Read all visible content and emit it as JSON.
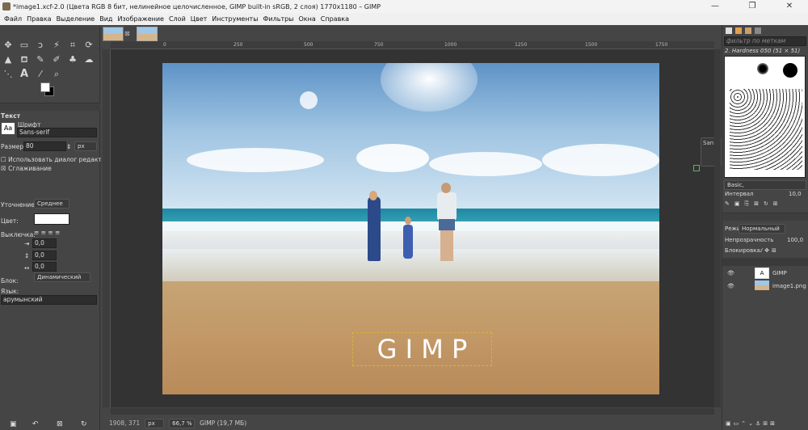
{
  "window": {
    "title": "*image1.xcf-2.0 (Цвета RGB 8 бит, нелинейное целочисленное, GIMP built-in sRGB, 2 слоя) 1770x1180 – GIMP",
    "minimize": "—",
    "maximize": "❐",
    "close": "✕"
  },
  "menu": [
    "Файл",
    "Правка",
    "Выделение",
    "Вид",
    "Изображение",
    "Слой",
    "Цвет",
    "Инструменты",
    "Фильтры",
    "Окна",
    "Справка"
  ],
  "text_tool": {
    "section": "Текст",
    "font_label": "Шрифт",
    "font_value": "Sans-serif",
    "size_label": "Размер:",
    "size_value": "80",
    "size_unit": "px",
    "use_editor": "Использовать диалог редактора",
    "antialias": "Сглаживание",
    "hinting_label": "Уточнение:",
    "hinting_value": "Среднее",
    "color_label": "Цвет:",
    "justify_label": "Выключка:",
    "indent": "0,0",
    "line_spacing": "0,0",
    "letter_spacing": "0,0",
    "box_label": "Блок:",
    "box_value": "Динамический",
    "lang_label": "Язык:",
    "lang_value": "арумынский"
  },
  "ruler": {
    "ticks": [
      "0",
      "250",
      "500",
      "750",
      "1000",
      "1250",
      "1500",
      "1750"
    ]
  },
  "canvas_text": "G I M P",
  "popup": "San",
  "status": {
    "coords": "1908, 371",
    "unit": "px",
    "zoom": "66,7 %",
    "info": "GIMP (19,7 МБ)"
  },
  "brushes": {
    "filter_placeholder": "фильтр по меткам",
    "current": "2. Hardness 050 (51 × 51)",
    "preset": "Basic,",
    "spacing_label": "Интервал",
    "spacing_value": "10,0"
  },
  "layers": {
    "mode_label": "Режим",
    "mode_value": "Нормальный",
    "opacity_label": "Непрозрачность",
    "opacity_value": "100,0",
    "lock_label": "Блокировка:",
    "items": [
      {
        "name": "GIMP"
      },
      {
        "name": "image1.png"
      }
    ]
  }
}
